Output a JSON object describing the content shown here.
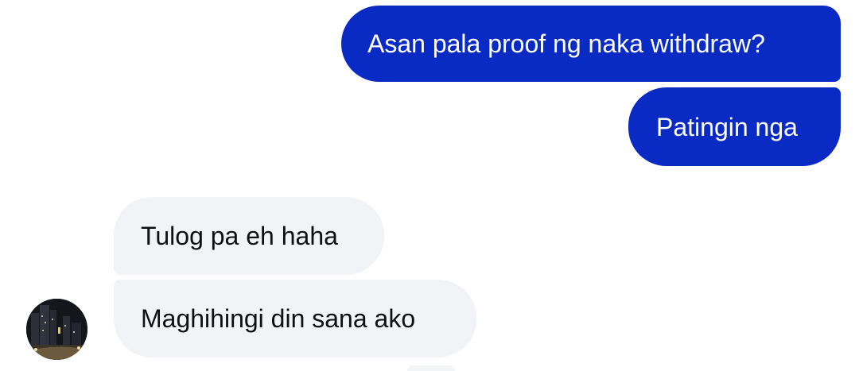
{
  "conversation": {
    "outgoing": [
      {
        "text": "Asan pala proof ng naka withdraw?"
      },
      {
        "text": "Patingin nga"
      }
    ],
    "incoming": [
      {
        "text": "Tulog pa eh haha"
      },
      {
        "text": "Maghihingi din sana ako"
      }
    ]
  },
  "contact": {
    "avatar_icon": "contact-avatar-photo"
  },
  "colors": {
    "outgoing_bubble": "#0a2ac4",
    "incoming_bubble": "#f1f3f6",
    "outgoing_text": "#ffffff",
    "incoming_text": "#101010"
  }
}
